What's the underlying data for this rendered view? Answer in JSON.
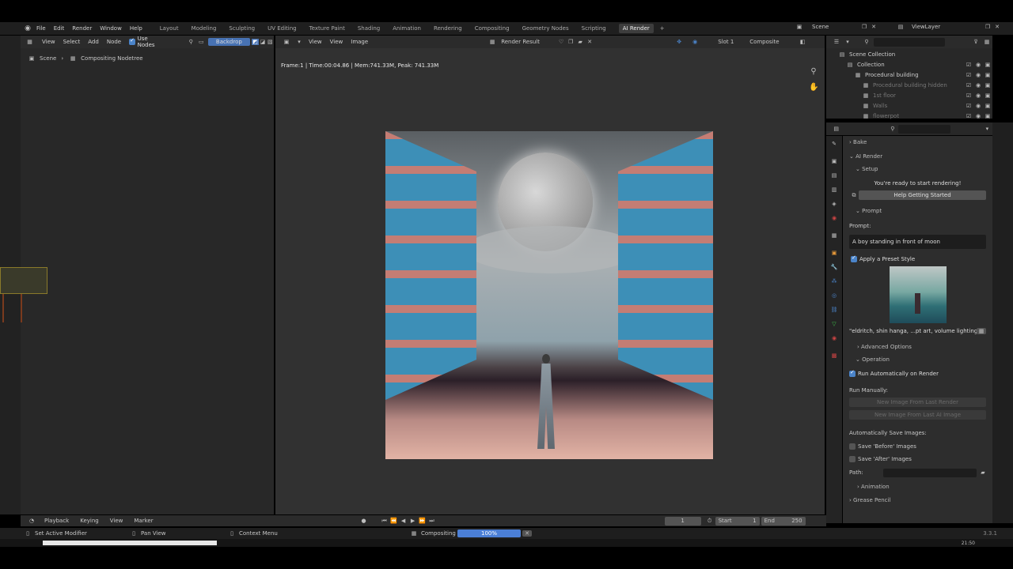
{
  "topbar": {
    "menus": [
      "File",
      "Edit",
      "Render",
      "Window",
      "Help"
    ],
    "workspaces": [
      "Layout",
      "Modeling",
      "Sculpting",
      "UV Editing",
      "Texture Paint",
      "Shading",
      "Animation",
      "Rendering",
      "Compositing",
      "Geometry Nodes",
      "Scripting",
      "AI Render"
    ],
    "active_workspace": "AI Render",
    "scene": "Scene",
    "view_layer": "ViewLayer"
  },
  "node_editor": {
    "menu": [
      "View",
      "Select",
      "Add",
      "Node"
    ],
    "use_nodes_label": "Use Nodes",
    "backdrop_label": "Backdrop",
    "breadcrumb": [
      "Scene",
      "Compositing Nodetree"
    ]
  },
  "image_editor": {
    "menu": [
      "View",
      "View",
      "Image"
    ],
    "image_name": "Render Result",
    "slot": "Slot 1",
    "layer": "Composite",
    "frame_info": "Frame:1 | Time:00:04.86 | Mem:741.33M, Peak: 741.33M"
  },
  "outliner": {
    "items": [
      {
        "label": "Scene Collection",
        "indent": 0,
        "dim": false
      },
      {
        "label": "Collection",
        "indent": 1,
        "dim": false
      },
      {
        "label": "Procedural building",
        "indent": 2,
        "dim": false
      },
      {
        "label": "Procedural building hidden",
        "indent": 3,
        "dim": true
      },
      {
        "label": "1st floor",
        "indent": 3,
        "dim": true
      },
      {
        "label": "Walls",
        "indent": 3,
        "dim": true
      },
      {
        "label": "flowerpot",
        "indent": 3,
        "dim": true
      }
    ]
  },
  "properties": {
    "bake": "Bake",
    "ai_render": "AI Render",
    "setup": "Setup",
    "ready_text": "You're ready to start rendering!",
    "help_button": "Help Getting Started",
    "prompt_section": "Prompt",
    "prompt_label": "Prompt:",
    "prompt_value": "A boy standing in front of moon",
    "apply_preset": "Apply a Preset Style",
    "preset_text": "\"eldritch, shin hanga, ...pt art, volume lighting\"",
    "advanced": "Advanced Options",
    "operation": "Operation",
    "run_auto": "Run Automatically on Render",
    "run_manually": "Run Manually:",
    "btn_new_from_last": "New Image From Last Render",
    "btn_new_from_ai": "New Image From Last AI Image",
    "auto_save": "Automatically Save Images:",
    "save_before": "Save 'Before' Images",
    "save_after": "Save 'After' Images",
    "path_label": "Path:",
    "animation": "Animation",
    "grease_pencil": "Grease Pencil"
  },
  "timeline": {
    "menus": [
      "Playback",
      "Keying",
      "View",
      "Marker"
    ],
    "current_frame": "1",
    "start_label": "Start",
    "start": "1",
    "end_label": "End",
    "end": "250"
  },
  "statusbar": {
    "left": "Set Active Modifier",
    "pan": "Pan View",
    "context": "Context Menu",
    "progress_label": "Compositing",
    "progress_text": "100%",
    "progress": 1.0,
    "version": "3.3.1",
    "time": "21:50"
  },
  "colors": {
    "accent": "#4772b3",
    "active_tab": "#3d3d3d",
    "progress": "#4b7fd6"
  }
}
